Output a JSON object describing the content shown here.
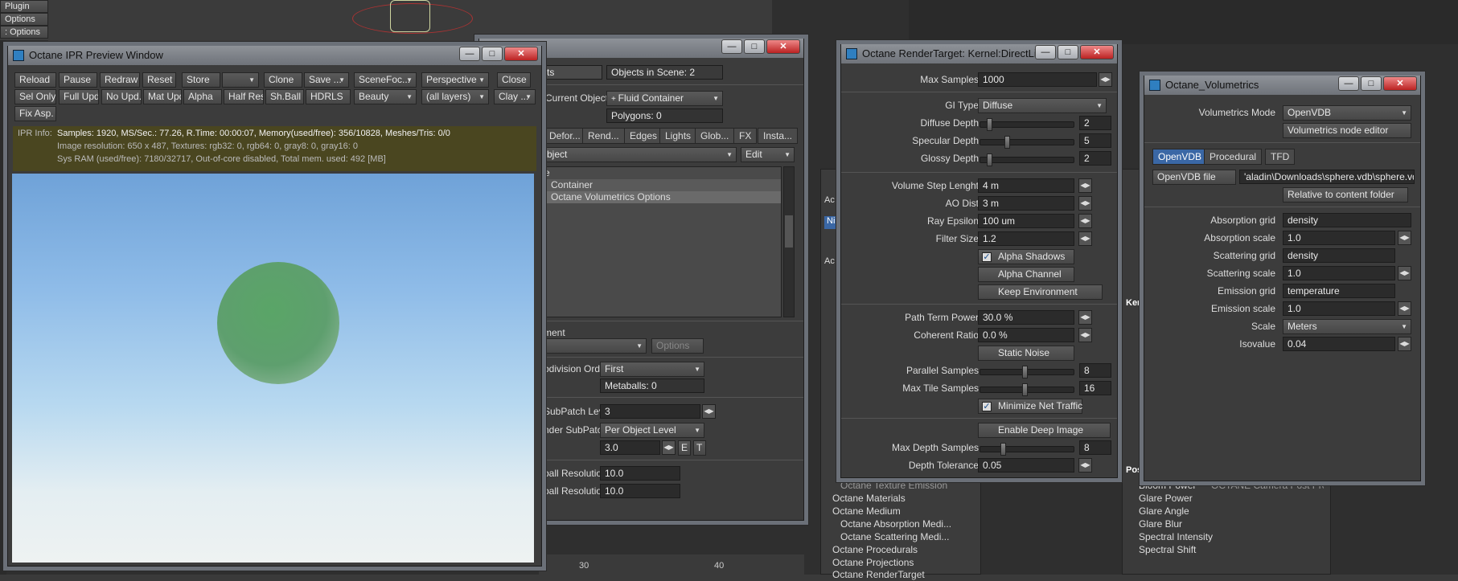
{
  "background_menu": {
    "items": [
      "Plugin",
      "Options",
      ": Options"
    ]
  },
  "ipr": {
    "title": "Octane IPR Preview Window",
    "toolbar_row1": [
      "Reload",
      "Pause",
      "Redraw",
      "Reset",
      "Store",
      "",
      "Clone",
      "Save ...",
      "SceneFoc...",
      "Perspective",
      "Close"
    ],
    "toolbar_row2": [
      "Sel Only",
      "Full Upd.",
      "No Upd.",
      "Mat Upd",
      "Alpha",
      "Half Res",
      "Sh.Ball",
      "HDRLS",
      "Beauty",
      "(all layers)",
      "Clay ..."
    ],
    "toolbar_row3": [
      "Fix Asp."
    ],
    "info_label": "IPR Info:",
    "info_line1": "Samples: 1920, MS/Sec.: 77.26, R.Time: 00:00:07, Memory(used/free): 356/10828, Meshes/Tris: 0/0",
    "info_line2": "Image resolution: 650 x 487, Textures: rgb32: 0, rgb64: 0, gray8: 0, gray16: 0",
    "info_line3": "Sys RAM (used/free): 7180/32717, Out-of-core disabled, Total mem. used: 492  [MB]"
  },
  "props": {
    "title": "...erties",
    "objects_count_field": "ts",
    "objects_in_scene": "Objects in Scene: 2",
    "current_object_label": "Current Object",
    "current_object_value": "Fluid Container",
    "polygons": "Polygons: 0",
    "tabs": [
      "Defor...",
      "Rend...",
      "Edges",
      "Lights",
      "Glob...",
      "FX",
      "Insta..."
    ],
    "object_dd": "bject",
    "edit_dd": "Edit",
    "list_header": "e",
    "list_items": [
      "Container",
      "Octane Volumetrics Options"
    ],
    "ment_label": "ment",
    "options_btn": "Options",
    "subdiv_order_label": "bdivision Order",
    "subdiv_order_value": "First",
    "metaballs": "Metaballs: 0",
    "subpatch_label": "SubPatch Level",
    "subpatch_value": "3",
    "render_subpatch_label": "nder SubPatch",
    "render_subpatch_value": "Per Object Level",
    "subpatch_num": "3.0",
    "e_btn": "E",
    "t_btn": "T",
    "ball_res1_label": "ball Resolution",
    "ball_res1_value": "10.0",
    "ball_res2_label": "ball Resolution",
    "ball_res2_value": "10.0"
  },
  "ruler": {
    "labels": [
      "30",
      "40"
    ]
  },
  "rt": {
    "title": "Octane RenderTarget: Kernel:DirectLig...",
    "max_samples_label": "Max Samples",
    "max_samples": "1000",
    "gi_type_label": "GI Type",
    "gi_type": "Diffuse",
    "diffuse_depth_label": "Diffuse Depth",
    "diffuse_depth": "2",
    "specular_depth_label": "Specular Depth",
    "specular_depth": "5",
    "glossy_depth_label": "Glossy Depth",
    "glossy_depth": "2",
    "vsl_label": "Volume Step Lenght",
    "vsl": "4 m",
    "ao_label": "AO Dist",
    "ao": "3 m",
    "ray_eps_label": "Ray Epsilon",
    "ray_eps": "100 um",
    "filter_label": "Filter Size",
    "filter": "1.2",
    "alpha_shadows": "Alpha Shadows",
    "alpha_channel": "Alpha Channel",
    "keep_env": "Keep Environment",
    "ptp_label": "Path Term Power",
    "ptp": "30.0 %",
    "coh_label": "Coherent Ratio",
    "coh": "0.0 %",
    "static_noise": "Static Noise",
    "par_label": "Parallel Samples",
    "par": "8",
    "mts_label": "Max Tile Samples",
    "mts": "16",
    "min_net": "Minimize Net Traffic",
    "deep_img": "Enable Deep Image",
    "mds_label": "Max Depth Samples",
    "mds": "8",
    "dt_label": "Depth Tolerance",
    "dt": "0.05"
  },
  "node_list": {
    "items": [
      "Octane Texture Emission",
      "Octane Materials",
      "Octane Medium",
      "Octane Absorption Medi...",
      "Octane Scattering Medi...",
      "Octane Procedurals",
      "Octane Projections",
      "Octane RenderTarget"
    ]
  },
  "kernel_list": {
    "header": "Kern",
    "pos_header": "Pos",
    "items": [
      "Bloom Power",
      "Glare Power",
      "Glare Angle",
      "Glare Blur",
      "Spectral Intensity",
      "Spectral Shift"
    ],
    "extra": "OCTANE Camera Post Pro..."
  },
  "vol": {
    "title": "Octane_Volumetrics",
    "mode_label": "Volumetrics Mode",
    "mode": "OpenVDB",
    "node_editor": "Volumetrics node editor",
    "tabs": [
      "OpenVDB",
      "Procedural",
      "TFD"
    ],
    "file_btn": "OpenVDB file",
    "file_path": "'aladin\\Downloads\\sphere.vdb\\sphere.vdb",
    "relative": "Relative to content folder",
    "abs_grid_label": "Absorption grid",
    "abs_grid": "density",
    "abs_scale_label": "Absorption scale",
    "abs_scale": "1.0",
    "sca_grid_label": "Scattering grid",
    "sca_grid": "density",
    "sca_scale_label": "Scattering scale",
    "sca_scale": "1.0",
    "emi_grid_label": "Emission grid",
    "emi_grid": "temperature",
    "emi_scale_label": "Emission scale",
    "emi_scale": "1.0",
    "scale_label": "Scale",
    "scale": "Meters",
    "iso_label": "Isovalue",
    "iso": "0.04"
  },
  "side_panel": {
    "labels": [
      "Ac",
      "Ni",
      "Ac"
    ]
  }
}
